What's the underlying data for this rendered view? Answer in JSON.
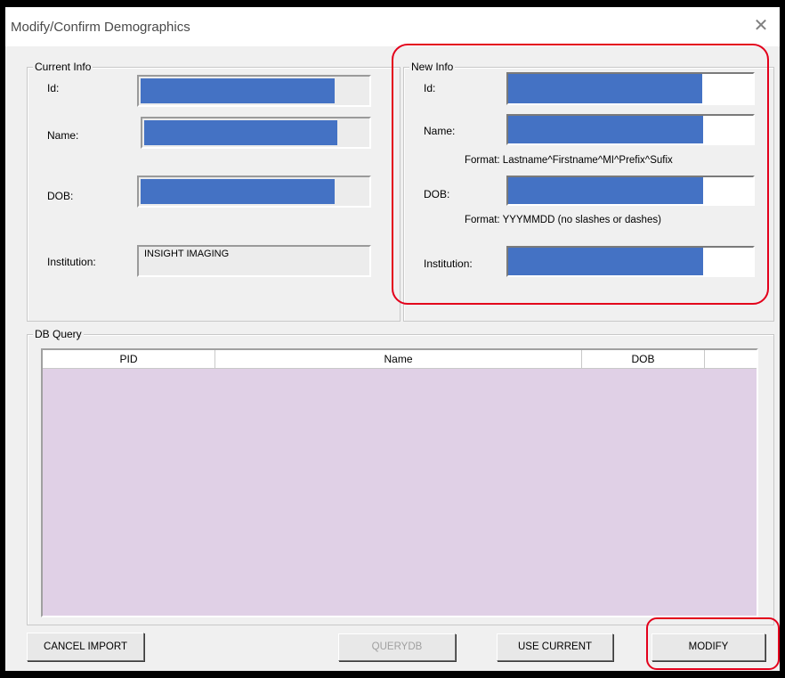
{
  "window": {
    "title": "Modify/Confirm Demographics",
    "close_glyph": "✕"
  },
  "current_info": {
    "legend": "Current Info",
    "id_label": "Id:",
    "name_label": "Name:",
    "dob_label": "DOB:",
    "institution_label": "Institution:",
    "institution_value": "INSIGHT IMAGING"
  },
  "new_info": {
    "legend": "New Info",
    "id_label": "Id:",
    "name_label": "Name:",
    "name_format": "Format: Lastname^Firstname^MI^Prefix^Sufix",
    "dob_label": "DOB:",
    "dob_format": "Format: YYYMMDD (no slashes or dashes)",
    "institution_label": "Institution:"
  },
  "db_query": {
    "legend": "DB Query",
    "columns": [
      "PID",
      "Name",
      "DOB"
    ]
  },
  "buttons": {
    "cancel_import": "CANCEL IMPORT",
    "querydb": "QUERYDB",
    "use_current": "USE CURRENT",
    "modify": "MODIFY"
  },
  "colors": {
    "redacted_fill": "#4472c4",
    "highlight": "#e3001b",
    "grid_bg": "#e0d0e6"
  }
}
